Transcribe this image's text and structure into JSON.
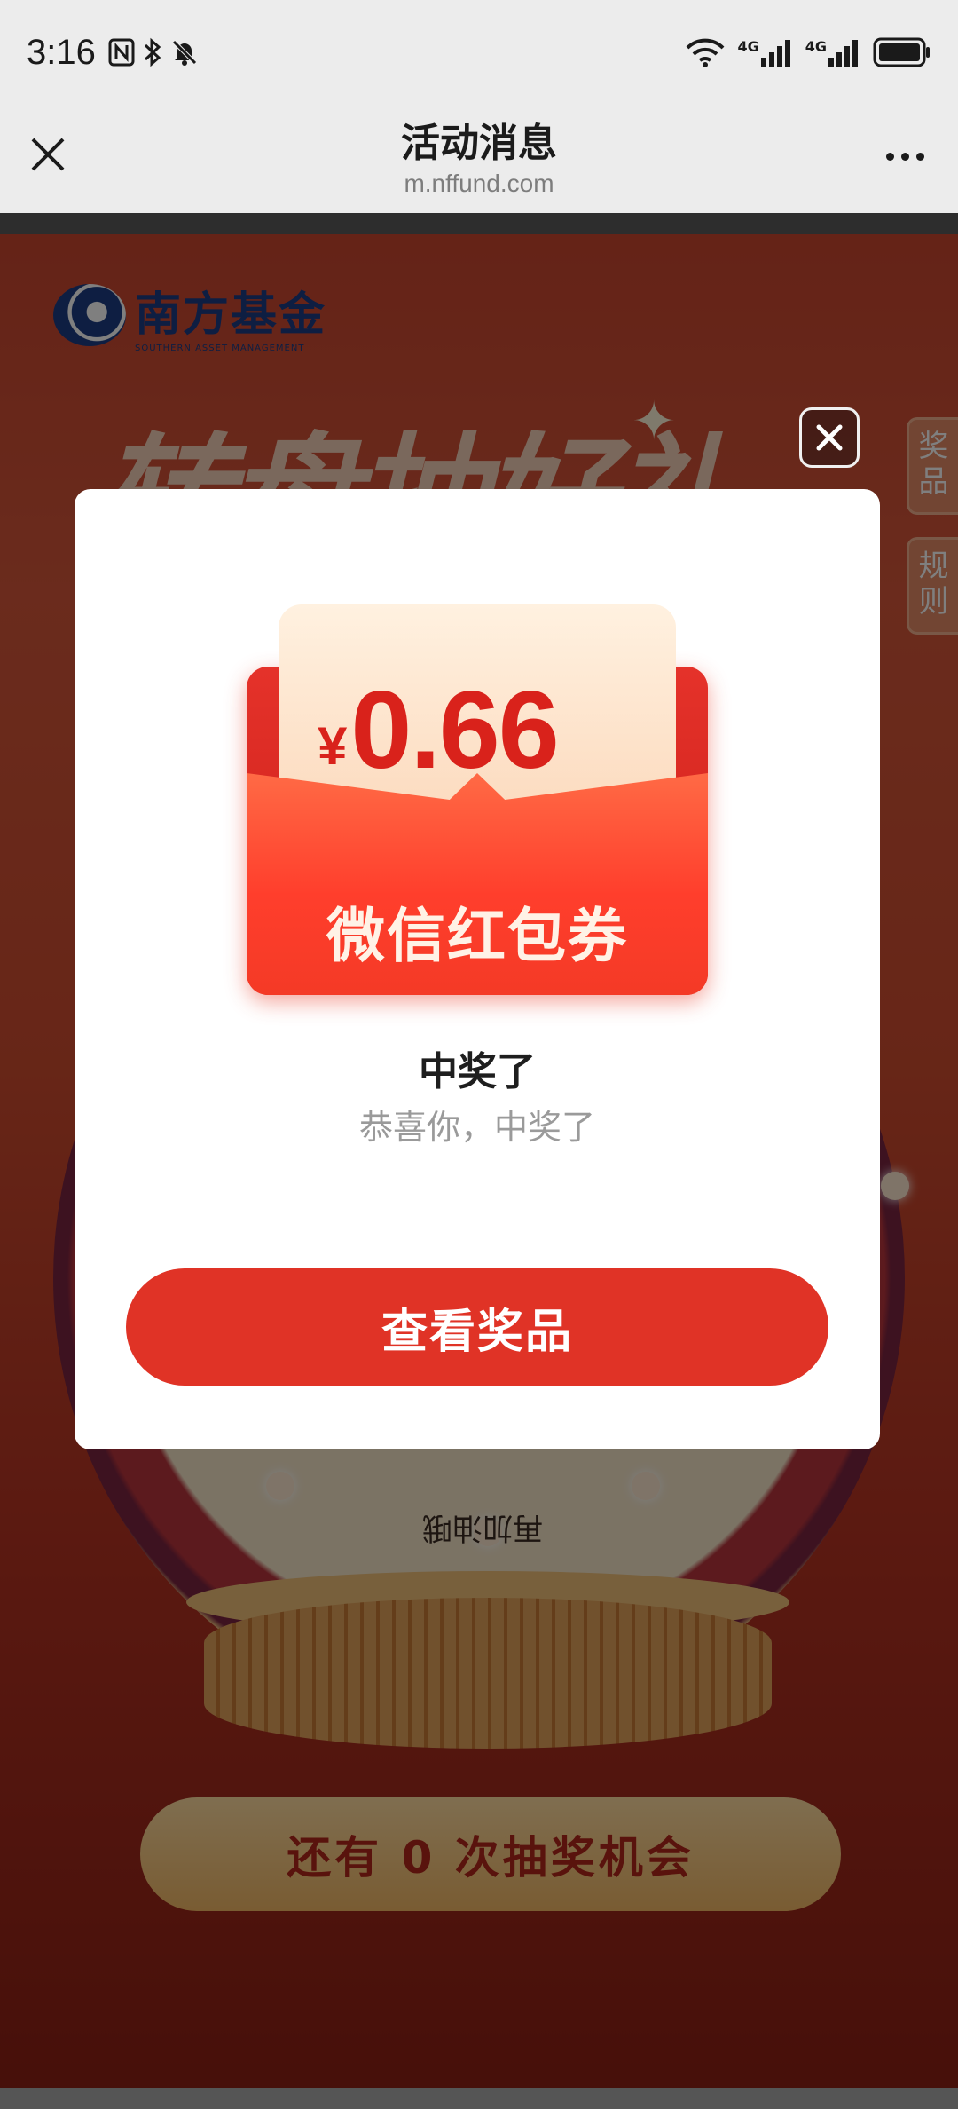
{
  "status_bar": {
    "time": "3:16",
    "icons": [
      "nfc-icon",
      "bluetooth-icon",
      "mute-icon",
      "wifi-icon",
      "signal-4g-icon",
      "signal-4g-icon",
      "battery-icon"
    ],
    "network_label_1": "4G",
    "network_label_2": "4G"
  },
  "header": {
    "title": "活动消息",
    "url": "m.nffund.com"
  },
  "page": {
    "brand": "南方基金",
    "brand_sub": "SOUTHERN ASSET MANAGEMENT",
    "headline": "转盘抽好礼",
    "side_tabs": [
      "奖品",
      "规则"
    ],
    "wheel_segment_label": "再加油哦",
    "chance_text": "还有 0 次抽奖机会"
  },
  "modal": {
    "currency_symbol": "¥",
    "amount": "0.66",
    "coupon_label": "微信红包券",
    "title": "中奖了",
    "subtitle": "恭喜你，中奖了",
    "button_label": "查看奖品"
  },
  "colors": {
    "accent_red": "#e03326",
    "page_bg": "#c9452e",
    "header_bg": "#ececec"
  }
}
